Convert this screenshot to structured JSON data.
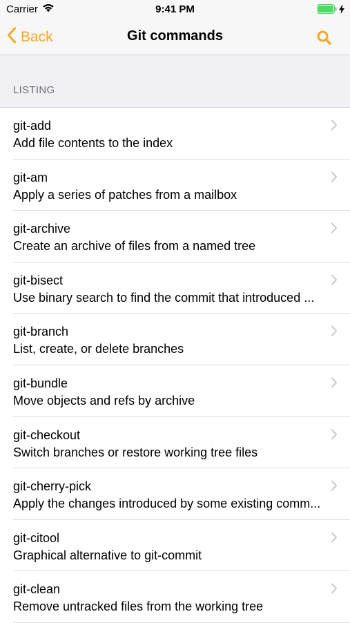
{
  "status_bar": {
    "carrier": "Carrier",
    "time": "9:41 PM"
  },
  "nav": {
    "back_label": "Back",
    "title": "Git commands",
    "accent": "#f5a623"
  },
  "section": {
    "title": "LISTING"
  },
  "commands": [
    {
      "name": "git-add",
      "desc": "Add file contents to the index"
    },
    {
      "name": "git-am",
      "desc": "Apply a series of patches from a mailbox"
    },
    {
      "name": "git-archive",
      "desc": "Create an archive of files from a named tree"
    },
    {
      "name": "git-bisect",
      "desc": "Use binary search to find the commit that introduced ..."
    },
    {
      "name": "git-branch",
      "desc": "List, create, or delete branches"
    },
    {
      "name": "git-bundle",
      "desc": "Move objects and refs by archive"
    },
    {
      "name": "git-checkout",
      "desc": "Switch branches or restore working tree files"
    },
    {
      "name": "git-cherry-pick",
      "desc": "Apply the changes introduced by some existing comm..."
    },
    {
      "name": "git-citool",
      "desc": "Graphical alternative to git-commit"
    },
    {
      "name": "git-clean",
      "desc": "Remove untracked files from the working tree"
    }
  ]
}
